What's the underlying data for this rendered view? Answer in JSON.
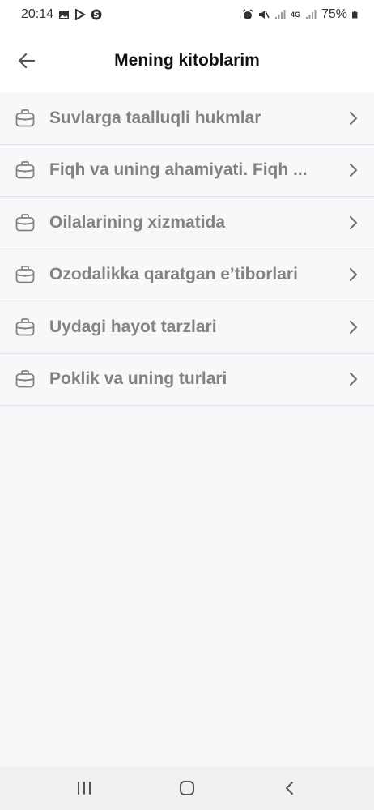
{
  "status_bar": {
    "time": "20:14",
    "battery": "75%",
    "network": "4G"
  },
  "header": {
    "title": "Mening kitoblarim"
  },
  "books": [
    {
      "title": "Suvlarga taalluqli hukmlar"
    },
    {
      "title": "Fiqh va uning ahamiyati. Fiqh ..."
    },
    {
      "title": "Oilalarining xizmatida"
    },
    {
      "title": "Ozodalikka qaratgan e’tiborlari"
    },
    {
      "title": "Uydagi hayot tarzlari"
    },
    {
      "title": "Poklik va uning turlari"
    }
  ],
  "colors": {
    "accent_text": "#828285",
    "background": "#f8f7f9",
    "divider": "#e3e2e6"
  },
  "icons": {
    "back": "arrow-left-icon",
    "item": "briefcase-icon",
    "chevron": "chevron-right-icon"
  }
}
